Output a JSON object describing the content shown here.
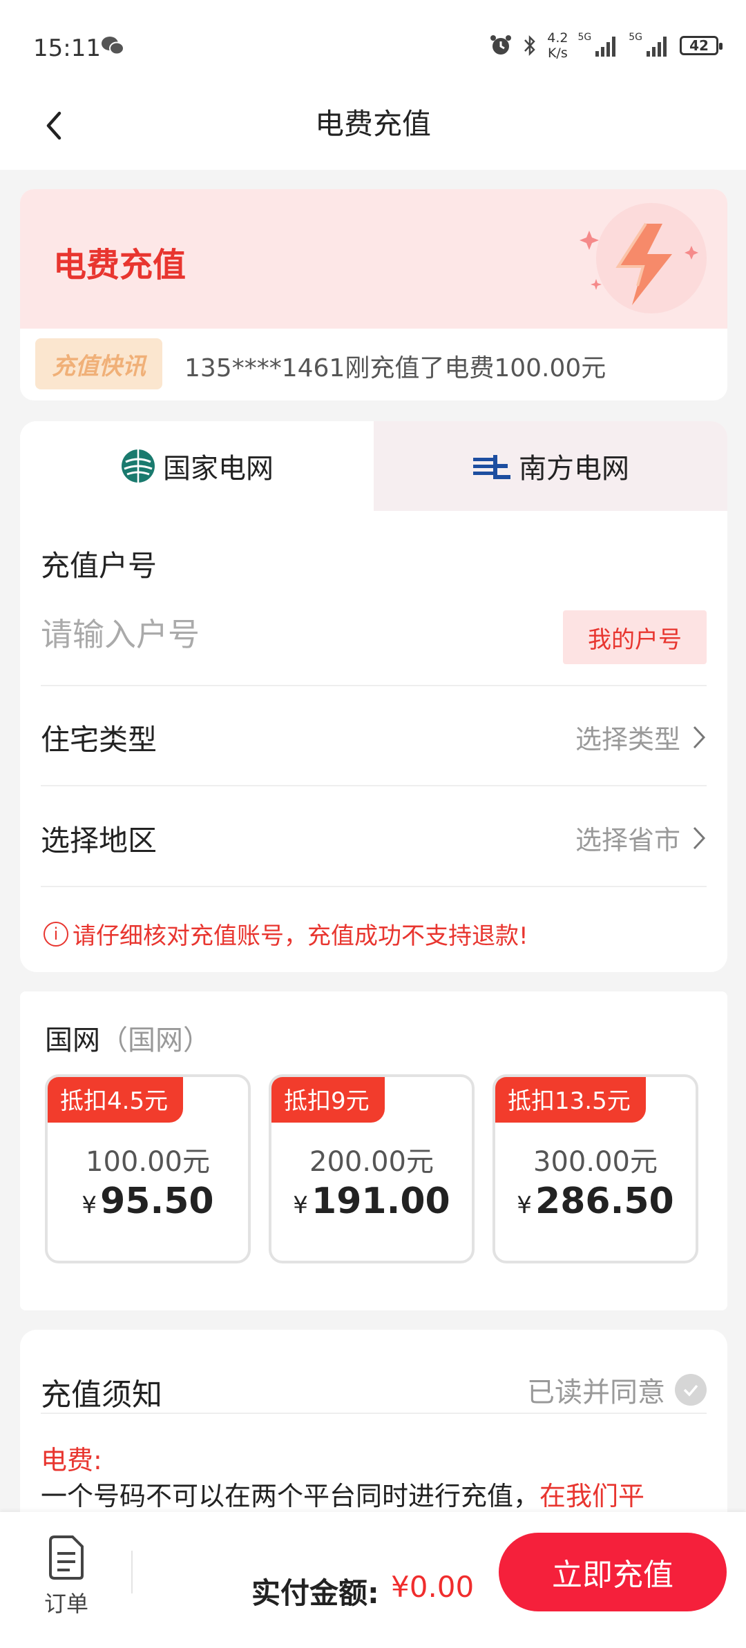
{
  "status_bar": {
    "time": "15:11",
    "speed_value": "4.2",
    "speed_unit": "K/s",
    "signal1": "5G",
    "signal2": "5G",
    "battery": "42"
  },
  "header": {
    "title": "电费充值"
  },
  "banner": {
    "title": "电费充值",
    "news_badge": "充值快讯",
    "news_text": "135****1461刚充值了电费100.00元"
  },
  "tabs": [
    {
      "label": "国家电网",
      "active": true
    },
    {
      "label": "南方电网",
      "active": false
    }
  ],
  "form": {
    "account_label": "充值户号",
    "account_placeholder": "请输入户号",
    "my_account_button": "我的户号",
    "house_type_label": "住宅类型",
    "house_type_value": "选择类型",
    "region_label": "选择地区",
    "region_value": "选择省市",
    "warning": "请仔细核对充值账号，充值成功不支持退款!"
  },
  "price": {
    "title": "国网",
    "subtitle": "（国网）",
    "options": [
      {
        "tag": "抵扣4.5元",
        "face": "100.00元",
        "yen": "¥",
        "pay": "95.50"
      },
      {
        "tag": "抵扣9元",
        "face": "200.00元",
        "yen": "¥",
        "pay": "191.00"
      },
      {
        "tag": "抵扣13.5元",
        "face": "300.00元",
        "yen": "¥",
        "pay": "286.50"
      }
    ]
  },
  "notice": {
    "title": "充值须知",
    "agree": "已读并同意",
    "subtitle": "电费:",
    "body_black": "一个号码不可以在两个平台同时进行充值，",
    "body_red": "在我们平"
  },
  "bottom": {
    "order_label": "订单",
    "total_label": "实付金额:",
    "total_value": "¥0.00",
    "pay_button": "立即充值"
  },
  "colors": {
    "accent": "#e8352f",
    "button": "#f5203b",
    "tag": "#f23c2c"
  }
}
